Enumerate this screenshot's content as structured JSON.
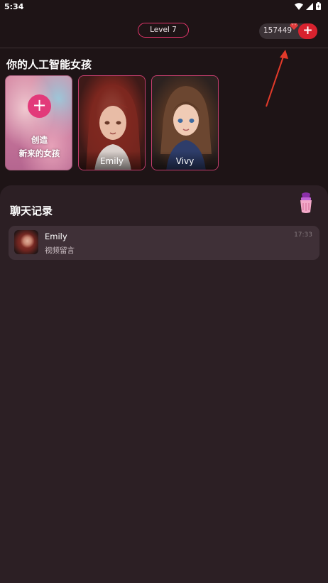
{
  "status_bar": {
    "time": "5:34"
  },
  "header": {
    "level": "Level 7",
    "coins": "157449",
    "add_coins_symbol": "+"
  },
  "girls_section": {
    "title": "你的人工智能女孩",
    "create_card": {
      "plus_symbol": "+",
      "label_line1": "创造",
      "label_line2": "新来的女孩"
    },
    "cards": [
      {
        "name": "Emily"
      },
      {
        "name": "Vivy"
      }
    ]
  },
  "chat_section": {
    "title": "聊天记录",
    "items": [
      {
        "name": "Emily",
        "last_message": "视频留言",
        "time": "17:33"
      }
    ]
  },
  "colors": {
    "background": "#1e1416",
    "accent_pink": "#e0356a",
    "add_button_red": "#d8222e",
    "annotation_arrow": "#e23a2a"
  }
}
